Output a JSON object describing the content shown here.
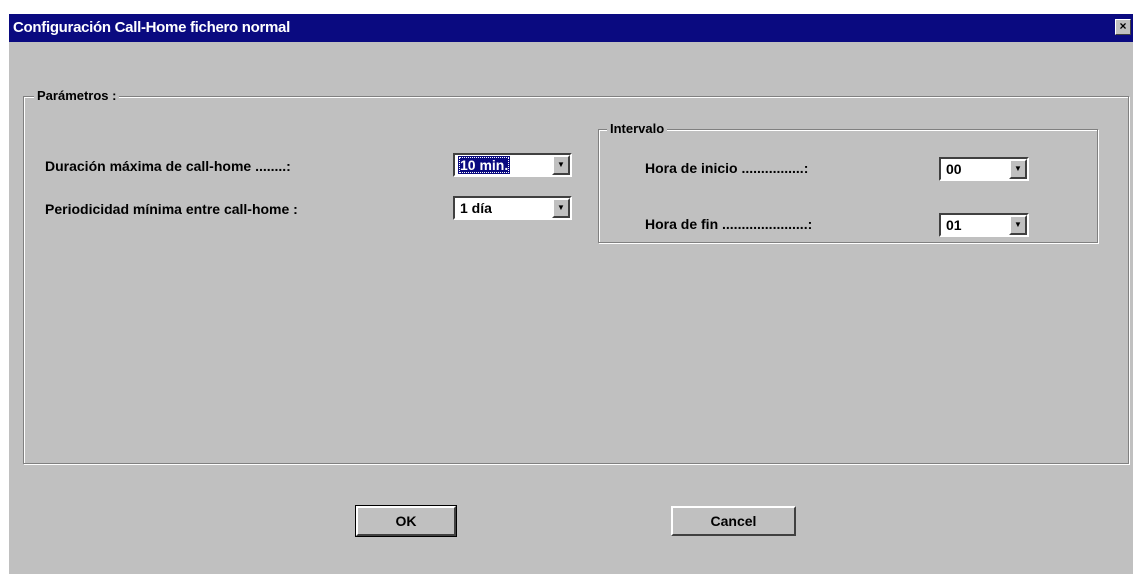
{
  "window": {
    "title": "Configuración Call-Home fichero normal",
    "close_glyph": "×"
  },
  "parametros": {
    "legend": "Parámetros :",
    "duracion_label": "Duración máxima de call-home ........:",
    "duracion_value": "10  min.",
    "periodicidad_label": "Periodicidad mínima entre call-home :",
    "periodicidad_value": "1 día"
  },
  "intervalo": {
    "legend": "Intervalo",
    "hora_inicio_label": "Hora  de inicio ................:",
    "hora_inicio_value": "00",
    "hora_fin_label": "Hora de fin ......................:",
    "hora_fin_value": "01"
  },
  "buttons": {
    "ok_label": "OK",
    "cancel_label": "Cancel"
  },
  "icons": {
    "dropdown_arrow": "▼"
  },
  "colors": {
    "title_bar": "#0a0a80",
    "dialog_face": "#c0c0c0"
  }
}
